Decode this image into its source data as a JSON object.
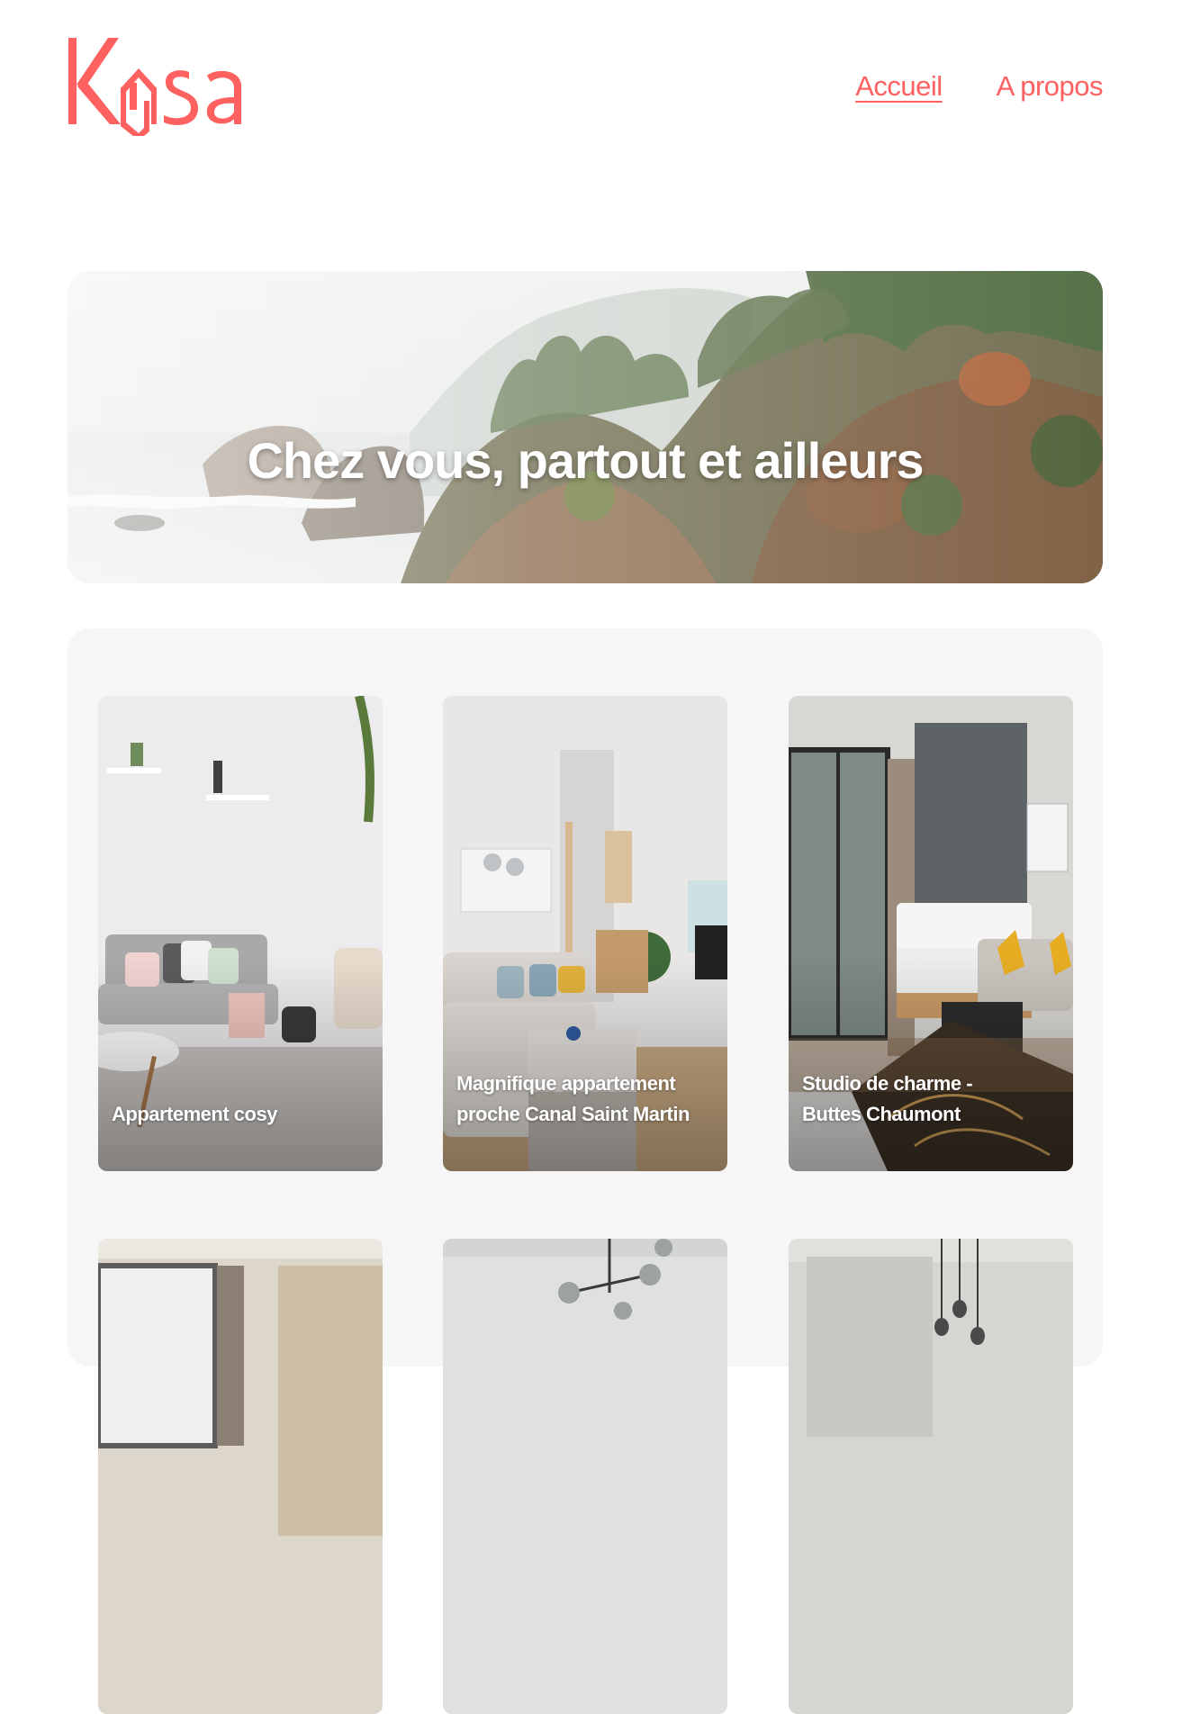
{
  "header": {
    "logo_text": "Kasa",
    "nav": [
      {
        "label": "Accueil",
        "active": true
      },
      {
        "label": "A propos",
        "active": false
      }
    ]
  },
  "banner": {
    "title": "Chez vous, partout et ailleurs"
  },
  "listings": [
    {
      "title": "Appartement cosy"
    },
    {
      "title": "Magnifique appartement proche Canal Saint Martin"
    },
    {
      "title": "Studio de charme - Buttes Chaumont"
    },
    {
      "title": ""
    },
    {
      "title": ""
    },
    {
      "title": ""
    }
  ],
  "colors": {
    "brand": "#FF6060",
    "gallery_bg": "#F6F6F6",
    "text_on_image": "#FFFFFF"
  }
}
